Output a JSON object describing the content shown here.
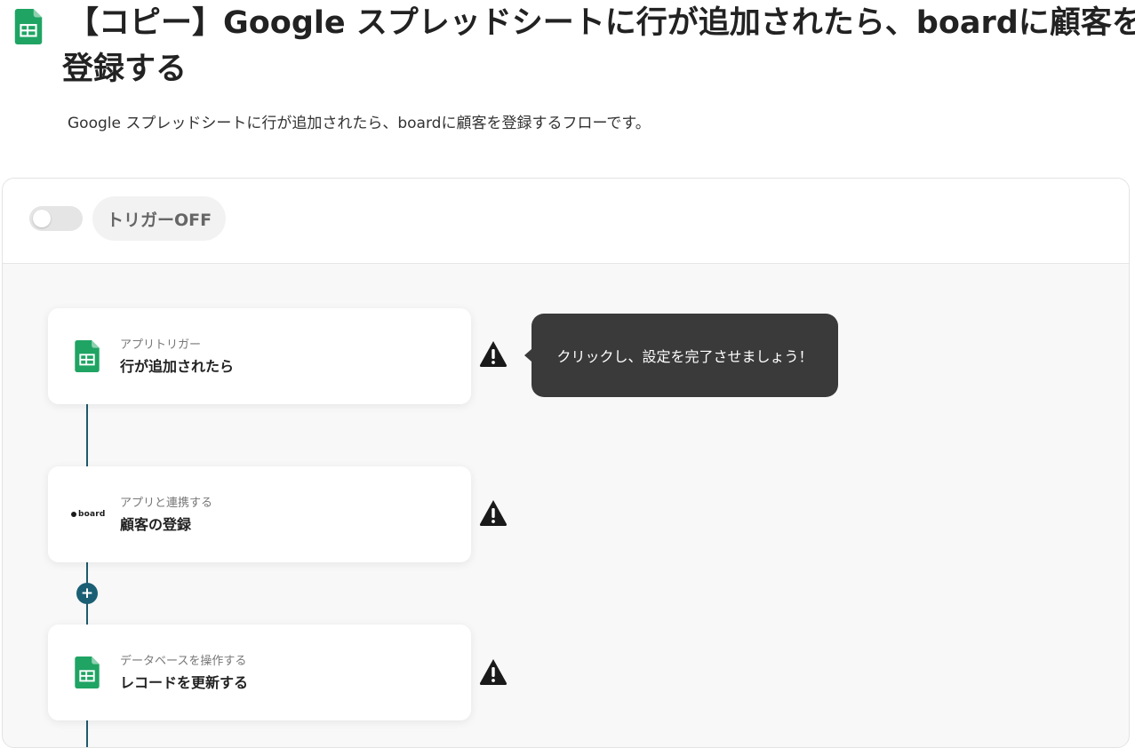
{
  "header": {
    "title_line1": "【コピー】Google スプレッドシートに行が追加されたら、boardに顧客を",
    "title_line2": "登録する",
    "description": "Google スプレッドシートに行が追加されたら、boardに顧客を登録するフローです。",
    "app_icon": "google-sheets-icon"
  },
  "trigger": {
    "toggle_on": false,
    "label": "トリガーOFF"
  },
  "flow": {
    "steps": [
      {
        "subtitle": "アプリトリガー",
        "title": "行が追加されたら",
        "app_icon": "google-sheets-icon",
        "status": "warning"
      },
      {
        "subtitle": "アプリと連携する",
        "title": "顧客の登録",
        "app_icon": "board-logo",
        "logo_text": "board",
        "status": "warning"
      },
      {
        "subtitle": "データベースを操作する",
        "title": "レコードを更新する",
        "app_icon": "google-sheets-icon",
        "status": "warning"
      }
    ],
    "tooltip": "クリックし、設定を完了させましょう！",
    "add_step_symbol": "+"
  },
  "colors": {
    "sheets_green": "#1FA463",
    "connector": "#1f5a6b",
    "tooltip_bg": "#3a3a3a",
    "warning": "#1a1a1a"
  }
}
